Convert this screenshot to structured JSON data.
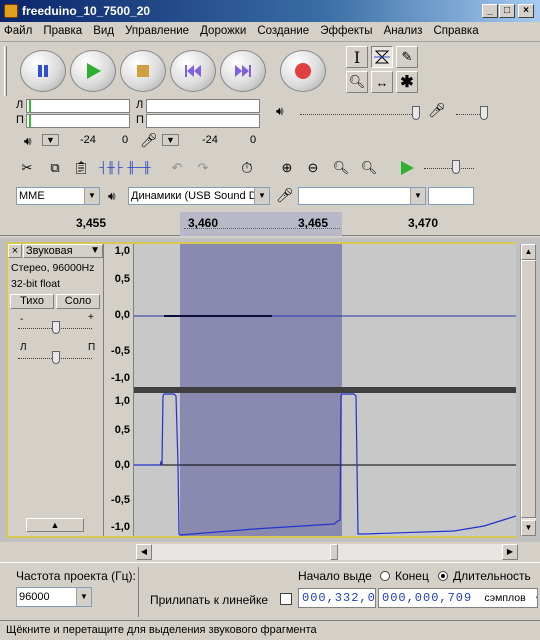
{
  "window": {
    "title": "freeduino_10_7500_20"
  },
  "menu": [
    "Файл",
    "Правка",
    "Вид",
    "Управление",
    "Дорожки",
    "Создание",
    "Эффекты",
    "Анализ",
    "Справка"
  ],
  "meters": {
    "left_channel": "Л",
    "right_channel": "П",
    "playback_db": "-24",
    "playback_zero": "0",
    "record_db": "-24",
    "record_zero": "0"
  },
  "devices": {
    "host": "MME",
    "output": "Динамики (USB Sound De",
    "input": ""
  },
  "ruler": {
    "labels": [
      "3,455",
      "3,460",
      "3,465",
      "3,470"
    ]
  },
  "track": {
    "name": "Звуковая",
    "format_line1": "Стерео, 96000Hz",
    "format_line2": "32-bit float",
    "mute_label": "Тихо",
    "solo_label": "Соло",
    "gain_minus": "-",
    "gain_plus": "+",
    "pan_left": "Л",
    "pan_right": "П",
    "yaxis_top": [
      "1,0",
      "0,5",
      "0,0",
      "-0,5",
      "-1,0"
    ],
    "yaxis_bottom": [
      "1,0",
      "0,5",
      "0,0",
      "-0,5",
      "-1,0"
    ]
  },
  "selection_bar": {
    "rate_label": "Частота проекта (Гц):",
    "rate_value": "96000",
    "snap_label": "Прилипать к линейке",
    "start_label": "Начало выде",
    "end_label": "Конец",
    "length_label": "Длительность",
    "start_value": "000,332,0",
    "length_value": "000,000,709",
    "unit_label": "сэмплов"
  },
  "status": {
    "text": "Щёкните и перетащите для выделения звукового фрагмента"
  },
  "colors": {
    "accent": "#0a246a",
    "waveform": "#2233cc",
    "selection": "#8a8ab0",
    "track_bg": "#c8c8c8"
  }
}
